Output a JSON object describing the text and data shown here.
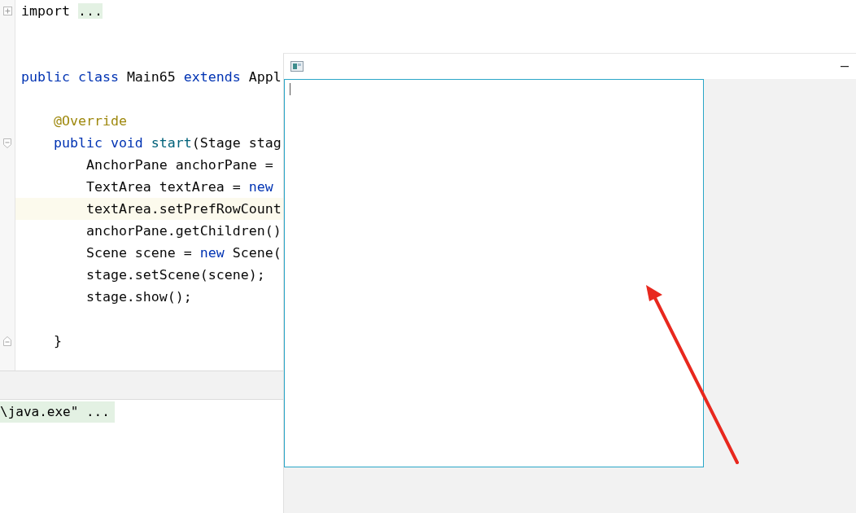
{
  "editor": {
    "lines": [
      {
        "kind": "folded",
        "current": false,
        "tokens": [
          {
            "kind": "plain",
            "text": "import "
          },
          {
            "kind": "folded",
            "text": "..."
          }
        ]
      },
      {
        "kind": "code",
        "current": false
      },
      {
        "kind": "code",
        "current": false
      },
      {
        "kind": "code",
        "current": false,
        "tokens": [
          {
            "kind": "keyword",
            "text": "public class "
          },
          {
            "kind": "plain",
            "text": "Main65 "
          },
          {
            "kind": "keyword",
            "text": "extends "
          },
          {
            "kind": "plain",
            "text": "Appl"
          }
        ]
      },
      {
        "kind": "code",
        "current": false
      },
      {
        "kind": "code",
        "current": false,
        "tokens": [
          {
            "kind": "annotation",
            "text": "    @Override"
          }
        ]
      },
      {
        "kind": "fold-start",
        "current": false,
        "tokens": [
          {
            "kind": "keyword",
            "text": "    public void "
          },
          {
            "kind": "method",
            "text": "start"
          },
          {
            "kind": "plain",
            "text": "(Stage stag"
          }
        ]
      },
      {
        "kind": "code",
        "current": false,
        "tokens": [
          {
            "kind": "plain",
            "text": "        AnchorPane anchorPane ="
          }
        ]
      },
      {
        "kind": "code",
        "current": false,
        "tokens": [
          {
            "kind": "plain",
            "text": "        TextArea textArea = "
          },
          {
            "kind": "keyword",
            "text": "new"
          }
        ]
      },
      {
        "kind": "code",
        "current": true,
        "tokens": [
          {
            "kind": "plain",
            "text": "        textArea.setPrefRowCount"
          }
        ]
      },
      {
        "kind": "code",
        "current": false,
        "tokens": [
          {
            "kind": "plain",
            "text": "        anchorPane.getChildren()"
          }
        ]
      },
      {
        "kind": "code",
        "current": false,
        "tokens": [
          {
            "kind": "plain",
            "text": "        Scene scene = "
          },
          {
            "kind": "keyword",
            "text": "new "
          },
          {
            "kind": "plain",
            "text": "Scene("
          }
        ]
      },
      {
        "kind": "code",
        "current": false,
        "tokens": [
          {
            "kind": "plain",
            "text": "        stage.setScene(scene);"
          }
        ]
      },
      {
        "kind": "code",
        "current": false,
        "tokens": [
          {
            "kind": "plain",
            "text": "        stage.show();"
          }
        ]
      },
      {
        "kind": "code",
        "current": false
      },
      {
        "kind": "fold-end",
        "current": false,
        "tokens": [
          {
            "kind": "plain",
            "text": "    }"
          }
        ]
      }
    ]
  },
  "console": {
    "lines": [
      {
        "text": "\\java.exe\" ...",
        "highlighted": true
      }
    ]
  },
  "app_window": {
    "text_area": {
      "focused": true
    }
  }
}
